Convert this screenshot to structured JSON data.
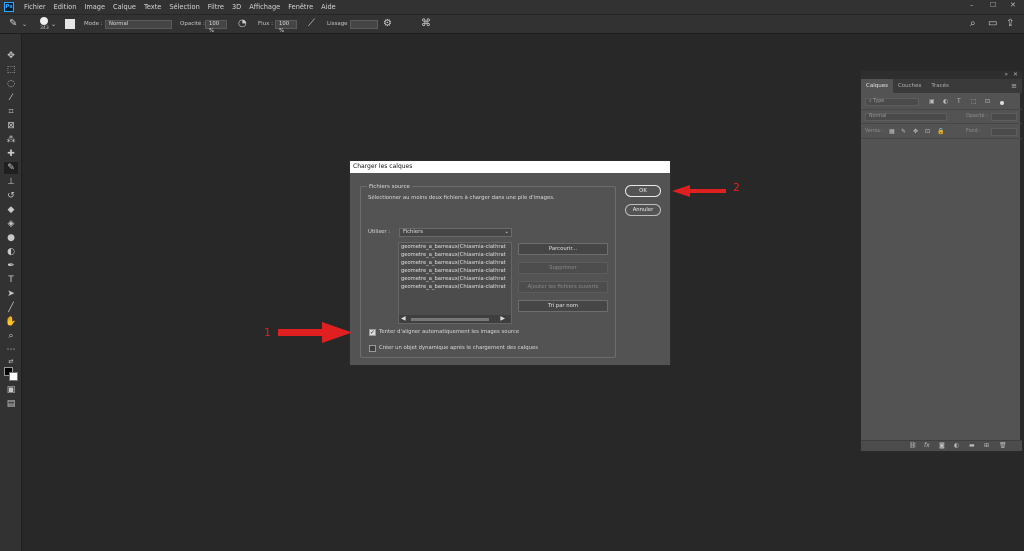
{
  "app": {
    "logo": "Ps",
    "menu": [
      "Fichier",
      "Edition",
      "Image",
      "Calque",
      "Texte",
      "Sélection",
      "Filtre",
      "3D",
      "Affichage",
      "Fenêtre",
      "Aide"
    ],
    "window_controls": [
      "–",
      "☐",
      "✕"
    ]
  },
  "options": {
    "brush_size": "343",
    "mode_label": "Mode :",
    "mode_value": "Normal",
    "opacity_label": "Opacité :",
    "opacity_value": "100 %",
    "flow_label": "Flux :",
    "flow_value": "100 %",
    "smoothing_label": "Lissage :",
    "smoothing_value": ""
  },
  "layers_panel": {
    "tabs": [
      "Calques",
      "Couches",
      "Tracés"
    ],
    "active_tab": 0,
    "filter_placeholder": "Type",
    "blend_mode": "Normal",
    "opacity_label": "Opacité :",
    "lock_label": "Verrou :",
    "fill_label": "Fond :"
  },
  "dialog": {
    "title": "Charger les calques",
    "group_title": "Fichiers source",
    "instruction": "Sélectionner au moins deux fichiers à charger dans une pile d'images.",
    "use_label": "Utiliser :",
    "use_value": "Fichiers",
    "files": [
      "geometre_a_barreaux(Chiasmia-clathrat",
      "geometre_a_barreaux(Chiasmia-clathrat",
      "geometre_a_barreaux(Chiasmia-clathrat",
      "geometre_a_barreaux(Chiasmia-clathrat",
      "geometre_a_barreaux(Chiasmia-clathrat",
      "geometre_a_barreaux(Chiasmia-clathrat"
    ],
    "browse_button": "Parcourir...",
    "remove_button": "Supprimer",
    "add_open_button": "Ajouter les fichiers ouverts",
    "sort_button": "Tri par nom",
    "auto_align_label": "Tenter d'aligner automatiquement les images source",
    "auto_align_checked": true,
    "smart_object_label": "Créer un objet dynamique après le chargement des calques",
    "smart_object_checked": false,
    "ok_button": "OK",
    "cancel_button": "Annuler"
  },
  "annotations": {
    "label_1": "1",
    "label_2": "2",
    "color": "#e02020"
  }
}
